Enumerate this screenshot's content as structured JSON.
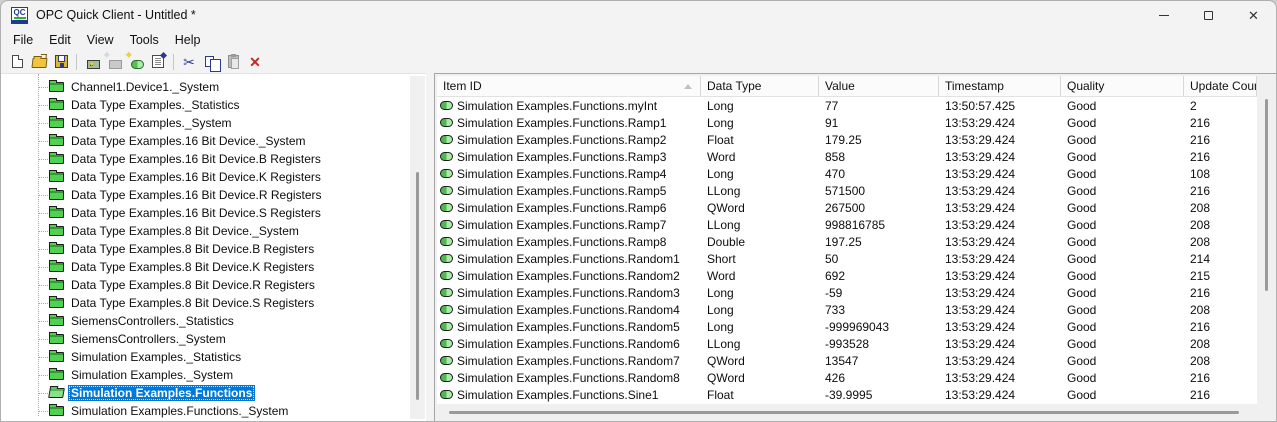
{
  "window": {
    "title": "OPC Quick Client - Untitled *",
    "app_icon_text": "QC",
    "controls": [
      "minimize",
      "maximize",
      "close"
    ]
  },
  "menu": {
    "items": [
      "File",
      "Edit",
      "View",
      "Tools",
      "Help"
    ]
  },
  "toolbar": {
    "buttons": [
      {
        "name": "new-file",
        "enabled": true
      },
      {
        "name": "open-folder",
        "enabled": true
      },
      {
        "name": "save",
        "enabled": true
      },
      {
        "name": "separator"
      },
      {
        "name": "new-server",
        "enabled": true,
        "sparkle": true
      },
      {
        "name": "new-group",
        "enabled": false,
        "sparkle": true
      },
      {
        "name": "new-item",
        "enabled": true,
        "sparkle": true
      },
      {
        "name": "properties",
        "enabled": true
      },
      {
        "name": "separator"
      },
      {
        "name": "cut",
        "enabled": true,
        "glyph": "✂"
      },
      {
        "name": "copy",
        "enabled": true
      },
      {
        "name": "paste",
        "enabled": false
      },
      {
        "name": "delete",
        "enabled": true,
        "glyph": "✕"
      }
    ]
  },
  "tree": {
    "items": [
      {
        "label": "Channel1.Device1._System",
        "selected": false
      },
      {
        "label": "Data Type Examples._Statistics",
        "selected": false
      },
      {
        "label": "Data Type Examples._System",
        "selected": false
      },
      {
        "label": "Data Type Examples.16 Bit Device._System",
        "selected": false
      },
      {
        "label": "Data Type Examples.16 Bit Device.B Registers",
        "selected": false
      },
      {
        "label": "Data Type Examples.16 Bit Device.K Registers",
        "selected": false
      },
      {
        "label": "Data Type Examples.16 Bit Device.R Registers",
        "selected": false
      },
      {
        "label": "Data Type Examples.16 Bit Device.S Registers",
        "selected": false
      },
      {
        "label": "Data Type Examples.8 Bit Device._System",
        "selected": false
      },
      {
        "label": "Data Type Examples.8 Bit Device.B Registers",
        "selected": false
      },
      {
        "label": "Data Type Examples.8 Bit Device.K Registers",
        "selected": false
      },
      {
        "label": "Data Type Examples.8 Bit Device.R Registers",
        "selected": false
      },
      {
        "label": "Data Type Examples.8 Bit Device.S Registers",
        "selected": false
      },
      {
        "label": "SiemensControllers._Statistics",
        "selected": false
      },
      {
        "label": "SiemensControllers._System",
        "selected": false
      },
      {
        "label": "Simulation Examples._Statistics",
        "selected": false
      },
      {
        "label": "Simulation Examples._System",
        "selected": false
      },
      {
        "label": "Simulation Examples.Functions",
        "selected": true
      },
      {
        "label": "Simulation Examples.Functions._System",
        "selected": false
      }
    ]
  },
  "table": {
    "columns": [
      "Item ID",
      "Data Type",
      "Value",
      "Timestamp",
      "Quality",
      "Update Count"
    ],
    "sort": {
      "column": "Item ID",
      "direction": "ascending"
    },
    "rows": [
      {
        "item_id": "Simulation Examples.Functions.myInt",
        "data_type": "Long",
        "value": "77",
        "timestamp": "13:50:57.425",
        "quality": "Good",
        "update_count": "2"
      },
      {
        "item_id": "Simulation Examples.Functions.Ramp1",
        "data_type": "Long",
        "value": "91",
        "timestamp": "13:53:29.424",
        "quality": "Good",
        "update_count": "216"
      },
      {
        "item_id": "Simulation Examples.Functions.Ramp2",
        "data_type": "Float",
        "value": "179.25",
        "timestamp": "13:53:29.424",
        "quality": "Good",
        "update_count": "216"
      },
      {
        "item_id": "Simulation Examples.Functions.Ramp3",
        "data_type": "Word",
        "value": "858",
        "timestamp": "13:53:29.424",
        "quality": "Good",
        "update_count": "216"
      },
      {
        "item_id": "Simulation Examples.Functions.Ramp4",
        "data_type": "Long",
        "value": "470",
        "timestamp": "13:53:29.424",
        "quality": "Good",
        "update_count": "108"
      },
      {
        "item_id": "Simulation Examples.Functions.Ramp5",
        "data_type": "LLong",
        "value": "571500",
        "timestamp": "13:53:29.424",
        "quality": "Good",
        "update_count": "216"
      },
      {
        "item_id": "Simulation Examples.Functions.Ramp6",
        "data_type": "QWord",
        "value": "267500",
        "timestamp": "13:53:29.424",
        "quality": "Good",
        "update_count": "208"
      },
      {
        "item_id": "Simulation Examples.Functions.Ramp7",
        "data_type": "LLong",
        "value": "998816785",
        "timestamp": "13:53:29.424",
        "quality": "Good",
        "update_count": "208"
      },
      {
        "item_id": "Simulation Examples.Functions.Ramp8",
        "data_type": "Double",
        "value": "197.25",
        "timestamp": "13:53:29.424",
        "quality": "Good",
        "update_count": "208"
      },
      {
        "item_id": "Simulation Examples.Functions.Random1",
        "data_type": "Short",
        "value": "50",
        "timestamp": "13:53:29.424",
        "quality": "Good",
        "update_count": "214"
      },
      {
        "item_id": "Simulation Examples.Functions.Random2",
        "data_type": "Word",
        "value": "692",
        "timestamp": "13:53:29.424",
        "quality": "Good",
        "update_count": "215"
      },
      {
        "item_id": "Simulation Examples.Functions.Random3",
        "data_type": "Long",
        "value": "-59",
        "timestamp": "13:53:29.424",
        "quality": "Good",
        "update_count": "216"
      },
      {
        "item_id": "Simulation Examples.Functions.Random4",
        "data_type": "Long",
        "value": "733",
        "timestamp": "13:53:29.424",
        "quality": "Good",
        "update_count": "208"
      },
      {
        "item_id": "Simulation Examples.Functions.Random5",
        "data_type": "Long",
        "value": "-999969043",
        "timestamp": "13:53:29.424",
        "quality": "Good",
        "update_count": "216"
      },
      {
        "item_id": "Simulation Examples.Functions.Random6",
        "data_type": "LLong",
        "value": "-993528",
        "timestamp": "13:53:29.424",
        "quality": "Good",
        "update_count": "208"
      },
      {
        "item_id": "Simulation Examples.Functions.Random7",
        "data_type": "QWord",
        "value": "13547",
        "timestamp": "13:53:29.424",
        "quality": "Good",
        "update_count": "208"
      },
      {
        "item_id": "Simulation Examples.Functions.Random8",
        "data_type": "QWord",
        "value": "426",
        "timestamp": "13:53:29.424",
        "quality": "Good",
        "update_count": "216"
      },
      {
        "item_id": "Simulation Examples.Functions.Sine1",
        "data_type": "Float",
        "value": "-39.9995",
        "timestamp": "13:53:29.424",
        "quality": "Good",
        "update_count": "216"
      }
    ]
  },
  "colors": {
    "selection_blue": "#0078d7",
    "folder_green": "#52d052",
    "item_icon_green": "#a9eca9",
    "delete_red": "#c22a1f",
    "chrome_gray": "#f3f3f3"
  }
}
